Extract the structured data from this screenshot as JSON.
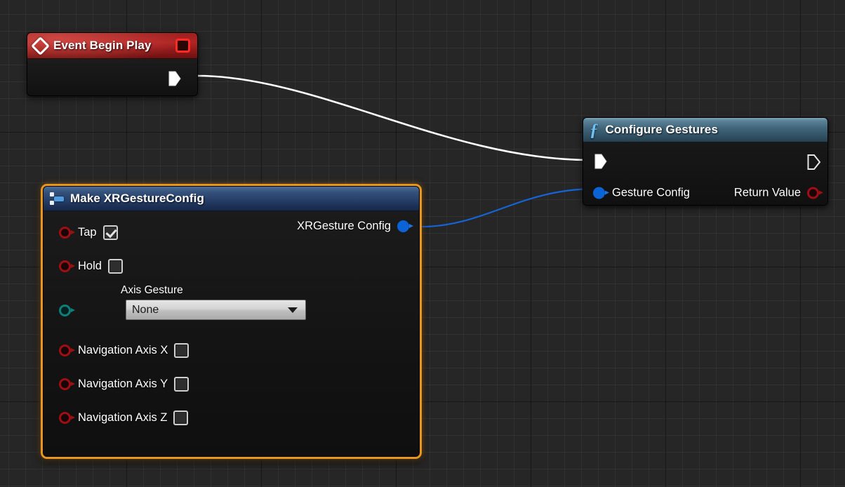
{
  "graph": {
    "background_color": "#262626",
    "grid_minor_color": "#3a3a3a",
    "grid_major_color": "#000000"
  },
  "nodes": {
    "event_begin_play": {
      "title": "Event Begin Play",
      "icon": "event-diamond-icon",
      "header_color": "#a02020",
      "stop_button": "stop-icon",
      "exec_out": "exec-output-pin"
    },
    "configure_gestures": {
      "title": "Configure Gestures",
      "icon": "function-f-icon",
      "header_color": "#3e6378",
      "exec_in_label": "",
      "exec_out_label": "",
      "input_pin_label": "Gesture Config",
      "output_pin_label": "Return Value",
      "input_pin_color": "#0b63d6",
      "output_pin_color": "#9e0f14"
    },
    "make_xrgestureconfig": {
      "title": "Make XRGestureConfig",
      "icon": "make-struct-icon",
      "selected": true,
      "selection_color": "#e8961e",
      "header_color": "#27406a",
      "output_pin_label": "XRGesture Config",
      "output_pin_color": "#0b63d6",
      "inputs": [
        {
          "label": "Tap",
          "type": "bool",
          "checked": true,
          "pin_color": "#9e0f14"
        },
        {
          "label": "Hold",
          "type": "bool",
          "checked": false,
          "pin_color": "#9e0f14"
        },
        {
          "label": "Axis Gesture",
          "type": "enum",
          "value": "None",
          "pin_color": "#0f7d78"
        },
        {
          "label": "Navigation Axis X",
          "type": "bool",
          "checked": false,
          "pin_color": "#9e0f14"
        },
        {
          "label": "Navigation Axis Y",
          "type": "bool",
          "checked": false,
          "pin_color": "#9e0f14"
        },
        {
          "label": "Navigation Axis Z",
          "type": "bool",
          "checked": false,
          "pin_color": "#9e0f14"
        }
      ],
      "collapse_arrow": "collapse-up-arrow-icon"
    }
  },
  "wires": [
    {
      "name": "exec-wire",
      "from": "event_begin_play.exec_out",
      "to": "configure_gestures.exec_in",
      "color": "#ffffff"
    },
    {
      "name": "data-wire",
      "from": "make_xrgestureconfig.output",
      "to": "configure_gestures.gesture_config",
      "color": "#1565d8"
    }
  ]
}
